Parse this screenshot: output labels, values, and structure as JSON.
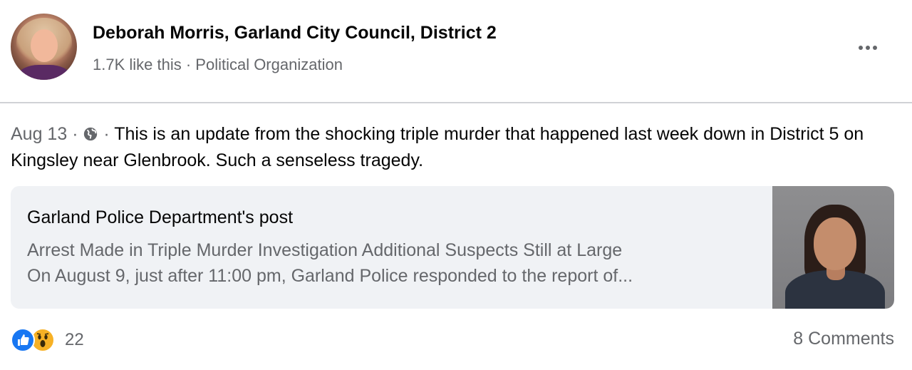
{
  "header": {
    "page_name": "Deborah Morris, Garland City Council, District 2",
    "page_meta": "1.7K like this · Political Organization"
  },
  "post": {
    "date": "Aug 13",
    "separator": " · ",
    "privacy_icon": "globe-icon",
    "text": "This is an update from the shocking triple murder that happened last week down in District 5 on Kingsley near Glenbrook. Such a senseless tragedy."
  },
  "shared_post": {
    "title": "Garland Police Department's post",
    "headline": "Arrest Made in Triple Murder Investigation Additional Suspects Still at Large",
    "snippet": "On August 9, just after 11:00 pm, Garland Police responded to the report of..."
  },
  "footer": {
    "reaction_icons": [
      "like-icon",
      "wow-icon"
    ],
    "reaction_count": "22",
    "comments": "8 Comments"
  },
  "colors": {
    "text_primary": "#050505",
    "text_secondary": "#65676b",
    "card_bg": "#f0f2f5",
    "like_blue": "#1877f2",
    "wow_yellow": "#f7b125"
  }
}
